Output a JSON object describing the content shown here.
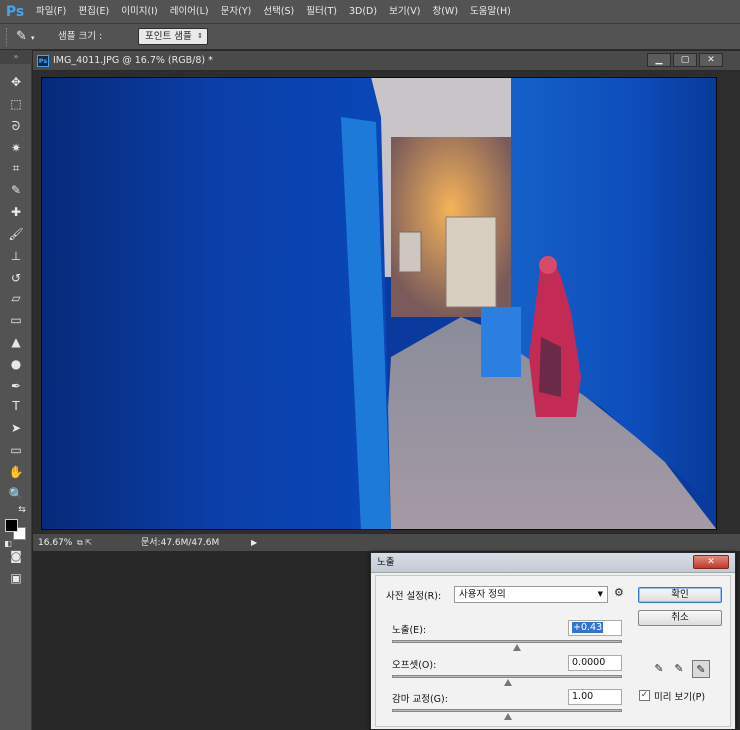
{
  "app": {
    "logo": "Ps"
  },
  "menu": [
    "파일(F)",
    "편집(E)",
    "이미지(I)",
    "레이어(L)",
    "문자(Y)",
    "선택(S)",
    "필터(T)",
    "3D(D)",
    "보기(V)",
    "창(W)",
    "도움말(H)"
  ],
  "options": {
    "tool_icon": "eyedropper-icon",
    "tool_glyph": "✎",
    "sample_label": "샘플 크기 :",
    "sample_value": "포인트 샘플"
  },
  "toolbox": {
    "tools": [
      {
        "name": "move-tool-icon",
        "glyph": "✥"
      },
      {
        "name": "marquee-tool-icon",
        "glyph": "⬚"
      },
      {
        "name": "lasso-tool-icon",
        "glyph": "ᘐ"
      },
      {
        "name": "magic-wand-tool-icon",
        "glyph": "✷"
      },
      {
        "name": "crop-tool-icon",
        "glyph": "⌗"
      },
      {
        "name": "eyedropper-tool-icon",
        "glyph": "✎"
      },
      {
        "name": "healing-brush-tool-icon",
        "glyph": "✚"
      },
      {
        "name": "brush-tool-icon",
        "glyph": "🖌"
      },
      {
        "name": "clone-stamp-tool-icon",
        "glyph": "⊥"
      },
      {
        "name": "history-brush-tool-icon",
        "glyph": "↺"
      },
      {
        "name": "eraser-tool-icon",
        "glyph": "▱"
      },
      {
        "name": "gradient-tool-icon",
        "glyph": "▭"
      },
      {
        "name": "blur-tool-icon",
        "glyph": "▲"
      },
      {
        "name": "dodge-tool-icon",
        "glyph": "●"
      },
      {
        "name": "pen-tool-icon",
        "glyph": "✒"
      },
      {
        "name": "type-tool-icon",
        "glyph": "T"
      },
      {
        "name": "path-selection-tool-icon",
        "glyph": "➤"
      },
      {
        "name": "shape-tool-icon",
        "glyph": "▭"
      },
      {
        "name": "hand-tool-icon",
        "glyph": "✋"
      },
      {
        "name": "zoom-tool-icon",
        "glyph": "🔍"
      }
    ],
    "foreground_color": "#000000",
    "background_color": "#ffffff"
  },
  "document": {
    "ps_badge": "Ps",
    "title": "IMG_4011.JPG @ 16.7% (RGB/8) *",
    "minimize": "▁",
    "maximize": "▢",
    "close": "✕",
    "zoom": "16.67%",
    "doc_size": "문서:47.6M/47.6M",
    "status_arrow": "▶"
  },
  "dialog": {
    "title": "노출",
    "close": "✕",
    "preset_label": "사전 설정(R):",
    "preset_value": "사용자 정의",
    "exposure_label": "노출(E):",
    "exposure_value": "+0.43",
    "exposure_level": 0.54,
    "offset_label": "오프셋(O):",
    "offset_value": "0.0000",
    "offset_level": 0.5,
    "gamma_label": "감마 교정(G):",
    "gamma_value": "1.00",
    "gamma_level": 0.5,
    "ok_label": "확인",
    "cancel_label": "취소",
    "preview_label": "미리 보기(P)",
    "preview_checked": true
  },
  "colors": {
    "wall_blue": "#0b3fa8",
    "accent_blue": "#3375d6",
    "ps_blue": "#4aa3e8"
  }
}
